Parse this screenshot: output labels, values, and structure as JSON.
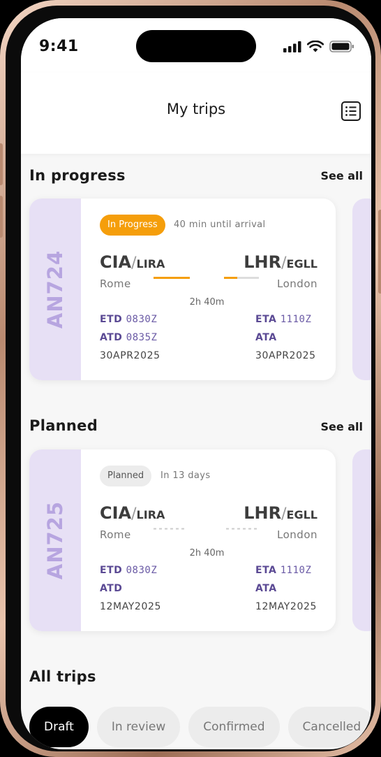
{
  "status_bar": {
    "time": "9:41"
  },
  "header": {
    "title": "My trips"
  },
  "sections": {
    "in_progress": {
      "title": "In progress",
      "see_all": "See all"
    },
    "planned": {
      "title": "Planned",
      "see_all": "See all"
    },
    "all_trips": {
      "title": "All trips"
    }
  },
  "trips": [
    {
      "flight": "AN724",
      "status": "In Progress",
      "note": "40 min until arrival",
      "origin": {
        "iata": "CIA",
        "icao": "LIRA",
        "city": "Rome"
      },
      "destination": {
        "iata": "LHR",
        "icao": "EGLL",
        "city": "London"
      },
      "duration": "2h 40m",
      "progress": 0.5,
      "etd_label": "ETD",
      "etd": "0830Z",
      "atd_label": "ATD",
      "atd": "0835Z",
      "eta_label": "ETA",
      "eta": "1110Z",
      "ata_label": "ATA",
      "ata": "",
      "dep_date": "30APR2025",
      "arr_date": "30APR2025"
    },
    {
      "flight": "AN725",
      "status": "Planned",
      "note": "In 13 days",
      "origin": {
        "iata": "CIA",
        "icao": "LIRA",
        "city": "Rome"
      },
      "destination": {
        "iata": "LHR",
        "icao": "EGLL",
        "city": "London"
      },
      "duration": "2h 40m",
      "progress": 0,
      "etd_label": "ETD",
      "etd": "0830Z",
      "atd_label": "ATD",
      "atd": "",
      "eta_label": "ETA",
      "eta": "1110Z",
      "ata_label": "ATA",
      "ata": "",
      "dep_date": "12MAY2025",
      "arr_date": "12MAY2025"
    }
  ],
  "filters": [
    "Draft",
    "In review",
    "Confirmed",
    "Cancelled"
  ],
  "colors": {
    "accent": "#f59e0b",
    "purple": "#5b4a94",
    "side": "#e7e0f5"
  }
}
